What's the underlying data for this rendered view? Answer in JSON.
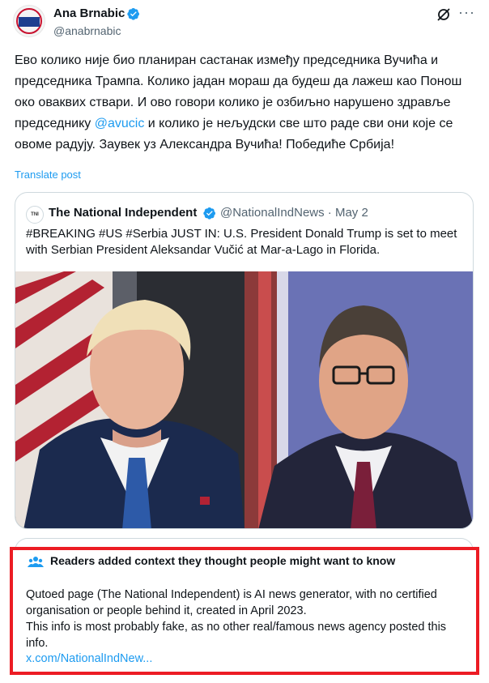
{
  "author": {
    "name": "Ana Brnabic",
    "handle": "@anabrnabic",
    "avatar_text": "СРБИЈА СУТРА"
  },
  "tweet": {
    "text_part1": "Ево колико није био планиран састанак између председника Вучића и председника Трампа. Колико јадан мораш да будеш да лажеш као Понош око оваквих ствари. И ово говори колико је озбиљно нарушено здравље председнику ",
    "mention": "@avucic",
    "text_part2": " и колико је нељудски све што раде сви они које се овоме радују. Заувек уз Александра Вучића! Победиће Србија!",
    "translate_label": "Translate post"
  },
  "quote": {
    "avatar_text": "TNI",
    "name": "The National Independent",
    "handle_date": "@NationalIndNews · May 2",
    "text": "#BREAKING #US #Serbia JUST IN: U.S. President Donald Trump is set to meet with Serbian President Aleksandar Vučić at Mar-a-Lago in Florida."
  },
  "community_note": {
    "title": "Readers added context they thought people might want to know",
    "body_line1": "Qutoed page (The National Independent) is AI news generator, with no certified organisation or people behind it, created in April 2023.",
    "body_line2": "This info is most probably fake, as no other real/famous news agency posted this info.",
    "link": "x.com/NationalIndNew..."
  },
  "colors": {
    "accent": "#1d9bf0",
    "highlight_border": "#ec1c24"
  }
}
